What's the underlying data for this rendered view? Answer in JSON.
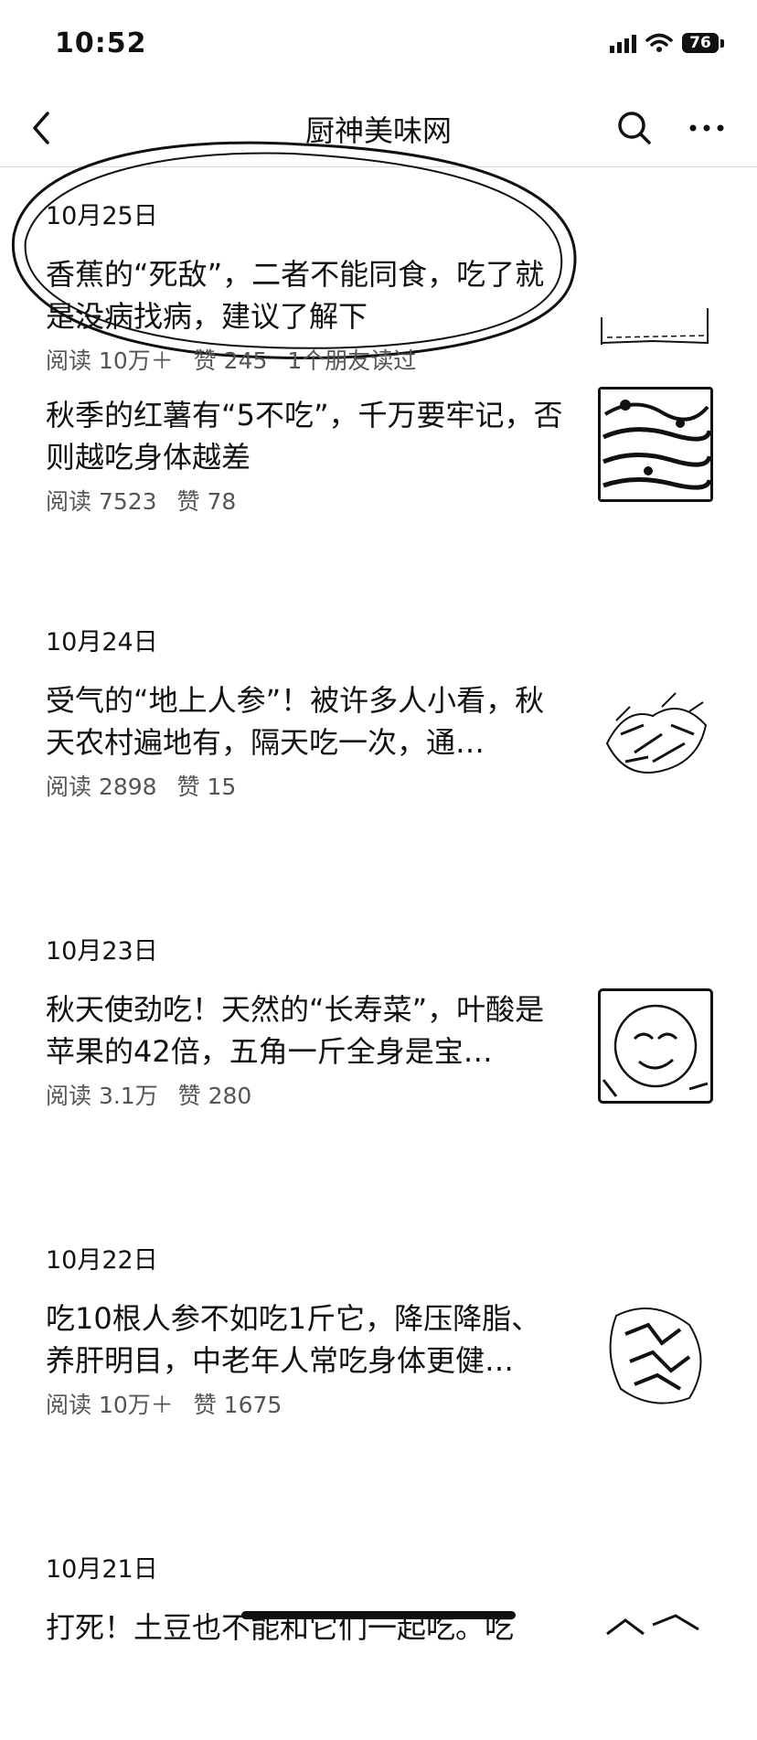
{
  "status": {
    "time": "10:52",
    "battery": "76"
  },
  "nav": {
    "title": "厨神美味网",
    "back_icon": "chevron-left-icon",
    "search_icon": "search-icon",
    "more_icon": "more-icon"
  },
  "groups": [
    {
      "date": "10月25日",
      "articles": [
        {
          "title": "香蕉的“死敌”，二者不能同食，吃了就是没病找病，建议了解下",
          "reads": "阅读 10万＋",
          "likes": "赞 245",
          "extra": "1个朋友读过"
        },
        {
          "title": "秋季的红薯有“5不吃”，千万要牢记，否则越吃身体越差",
          "reads": "阅读 7523",
          "likes": "赞 78",
          "extra": ""
        }
      ]
    },
    {
      "date": "10月24日",
      "articles": [
        {
          "title": "受气的“地上人参”！被许多人小看，秋天农村遍地有，隔天吃一次，通…",
          "reads": "阅读 2898",
          "likes": "赞 15",
          "extra": ""
        }
      ]
    },
    {
      "date": "10月23日",
      "articles": [
        {
          "title": "秋天使劲吃！天然的“长寿菜”，叶酸是苹果的42倍，五角一斤全身是宝…",
          "reads": "阅读 3.1万",
          "likes": "赞 280",
          "extra": ""
        }
      ]
    },
    {
      "date": "10月22日",
      "articles": [
        {
          "title": "吃10根人参不如吃1斤它，降压降脂、养肝明目，中老年人常吃身体更健…",
          "reads": "阅读 10万＋",
          "likes": "赞 1675",
          "extra": ""
        }
      ]
    },
    {
      "date": "10月21日",
      "articles": [
        {
          "title": "打死！土豆也不能和它们一起吃。吃",
          "reads": "",
          "likes": "",
          "extra": ""
        }
      ]
    }
  ]
}
